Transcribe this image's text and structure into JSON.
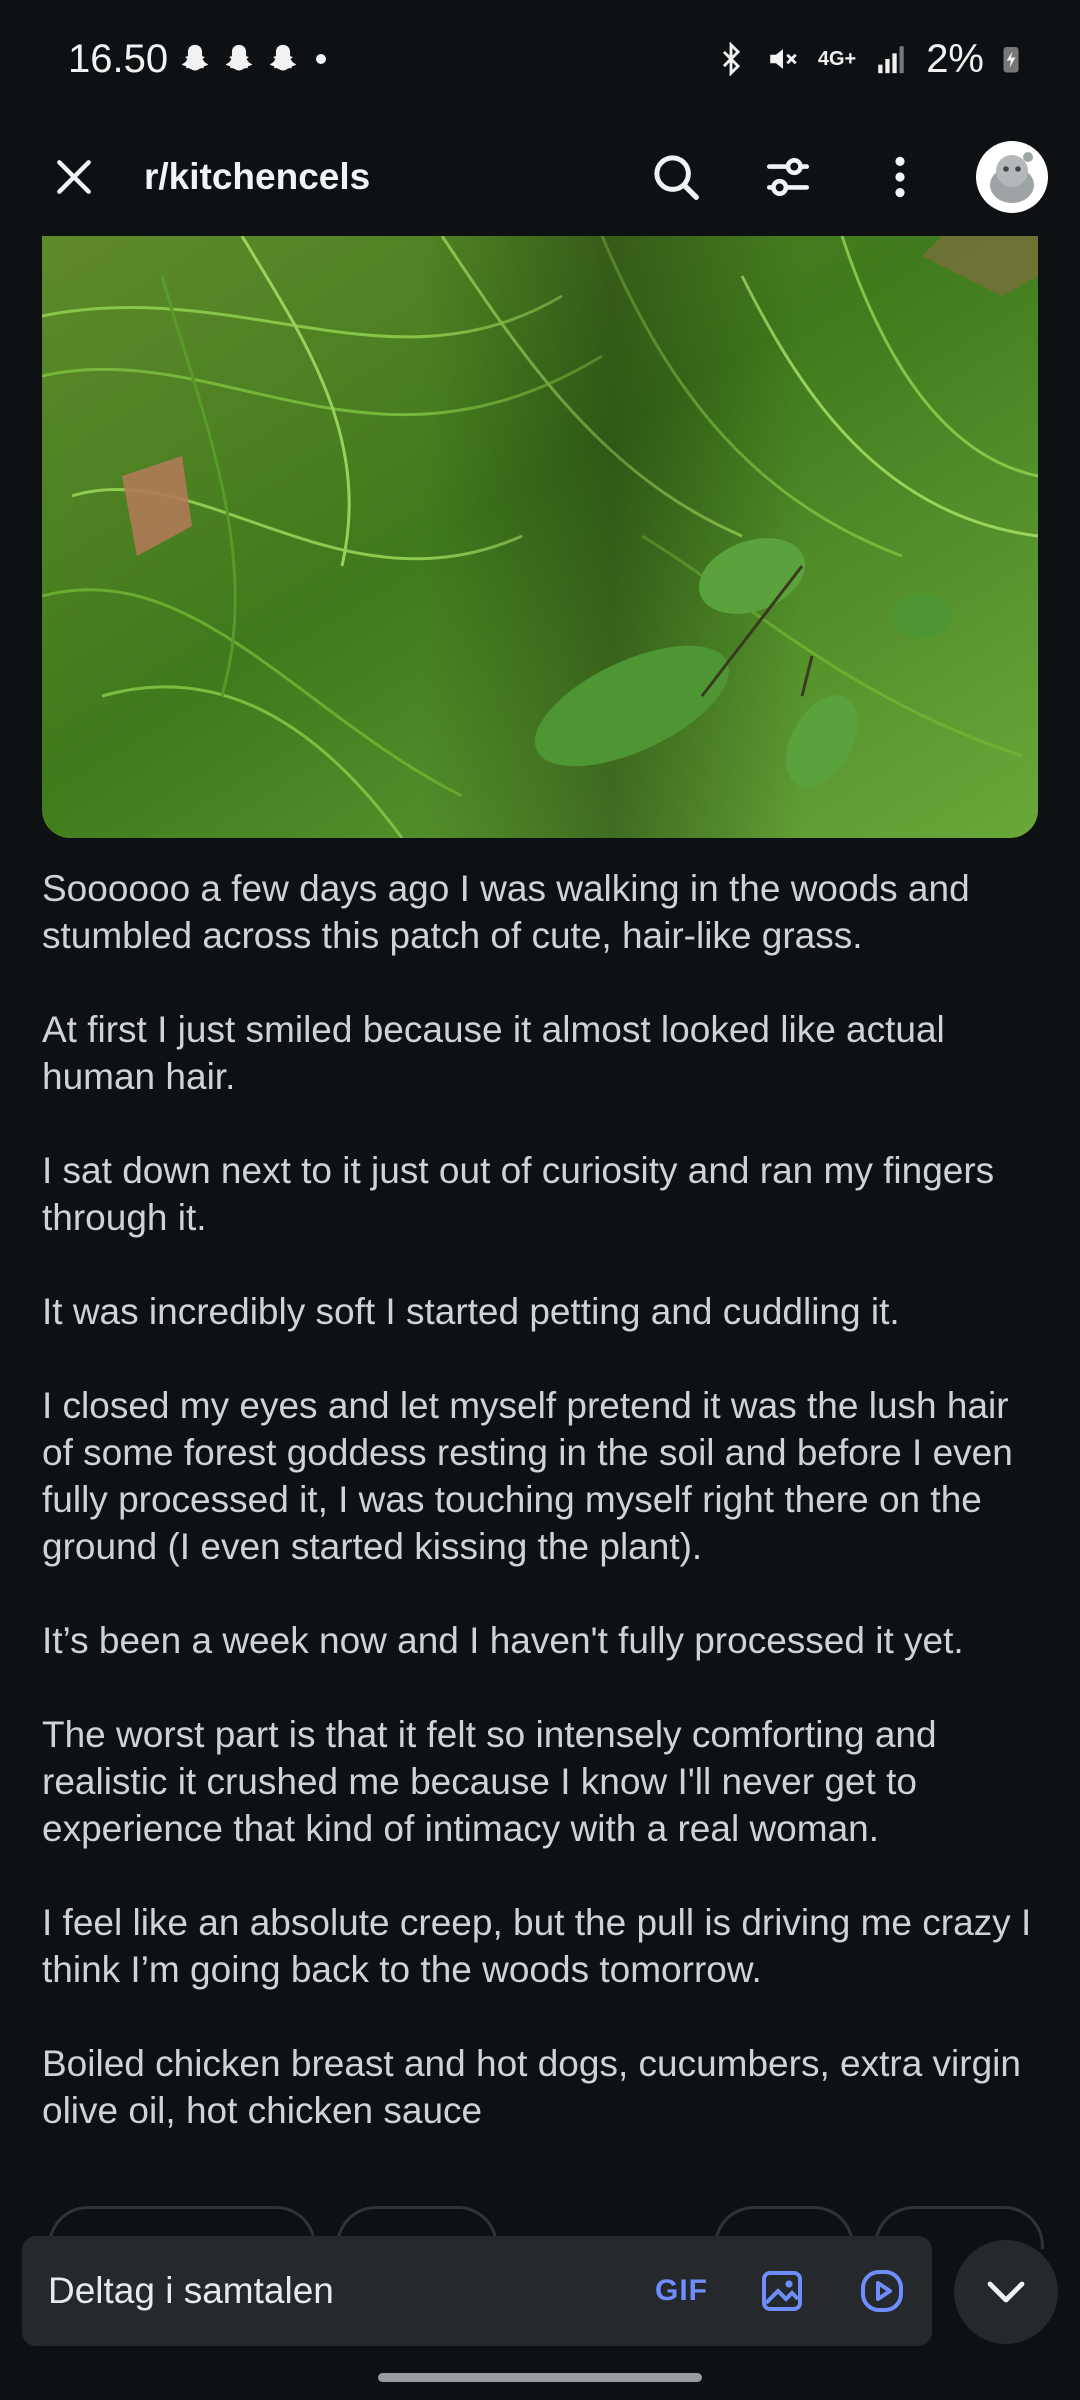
{
  "status_bar": {
    "time": "16.50",
    "network": "4G+",
    "battery": "2%"
  },
  "header": {
    "subreddit": "r/kitchencels",
    "icons": [
      "close-icon",
      "search-icon",
      "filter-icon",
      "more-icon",
      "avatar"
    ]
  },
  "post": {
    "paragraphs": [
      "Soooooo a few days ago I was walking in the woods and stumbled across this patch of cute, hair-like grass.",
      "At first I just smiled because it almost looked like actual human hair.",
      "I sat down next to it just out of curiosity and ran my fingers through it.",
      "It was incredibly soft I started petting and cuddling it.",
      "I closed my eyes and let myself pretend it was the lush hair of some forest goddess resting in the soil and before I even fully processed it, I was touching myself right there on the ground (I even started kissing the plant).",
      "It’s been a week now and I haven't fully processed it yet.",
      "The worst part is that it felt so intensely comforting and realistic it crushed me because I know I'll never get to experience that kind of intimacy with a real woman.",
      "I feel like an absolute creep, but the pull is driving me crazy I think I’m going back to the woods tomorrow.",
      "Boiled chicken breast and hot dogs, cucumbers, extra virgin olive oil, hot chicken sauce"
    ]
  },
  "comment_bar": {
    "placeholder": "Deltag i samtalen",
    "gif_label": "GIF"
  },
  "colors": {
    "background": "#0e1113",
    "accent": "#6e8eff",
    "bar": "#25292c"
  }
}
